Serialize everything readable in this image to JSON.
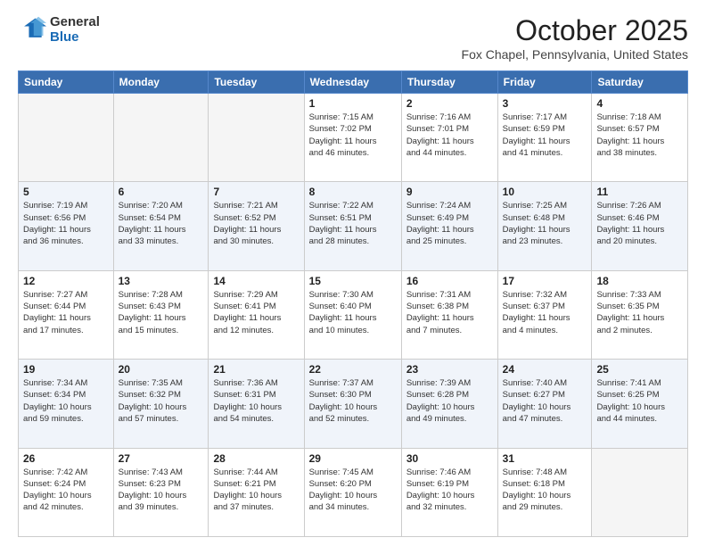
{
  "logo": {
    "general": "General",
    "blue": "Blue"
  },
  "header": {
    "month": "October 2025",
    "location": "Fox Chapel, Pennsylvania, United States"
  },
  "days_of_week": [
    "Sunday",
    "Monday",
    "Tuesday",
    "Wednesday",
    "Thursday",
    "Friday",
    "Saturday"
  ],
  "weeks": [
    [
      {
        "day": "",
        "info": ""
      },
      {
        "day": "",
        "info": ""
      },
      {
        "day": "",
        "info": ""
      },
      {
        "day": "1",
        "info": "Sunrise: 7:15 AM\nSunset: 7:02 PM\nDaylight: 11 hours\nand 46 minutes."
      },
      {
        "day": "2",
        "info": "Sunrise: 7:16 AM\nSunset: 7:01 PM\nDaylight: 11 hours\nand 44 minutes."
      },
      {
        "day": "3",
        "info": "Sunrise: 7:17 AM\nSunset: 6:59 PM\nDaylight: 11 hours\nand 41 minutes."
      },
      {
        "day": "4",
        "info": "Sunrise: 7:18 AM\nSunset: 6:57 PM\nDaylight: 11 hours\nand 38 minutes."
      }
    ],
    [
      {
        "day": "5",
        "info": "Sunrise: 7:19 AM\nSunset: 6:56 PM\nDaylight: 11 hours\nand 36 minutes."
      },
      {
        "day": "6",
        "info": "Sunrise: 7:20 AM\nSunset: 6:54 PM\nDaylight: 11 hours\nand 33 minutes."
      },
      {
        "day": "7",
        "info": "Sunrise: 7:21 AM\nSunset: 6:52 PM\nDaylight: 11 hours\nand 30 minutes."
      },
      {
        "day": "8",
        "info": "Sunrise: 7:22 AM\nSunset: 6:51 PM\nDaylight: 11 hours\nand 28 minutes."
      },
      {
        "day": "9",
        "info": "Sunrise: 7:24 AM\nSunset: 6:49 PM\nDaylight: 11 hours\nand 25 minutes."
      },
      {
        "day": "10",
        "info": "Sunrise: 7:25 AM\nSunset: 6:48 PM\nDaylight: 11 hours\nand 23 minutes."
      },
      {
        "day": "11",
        "info": "Sunrise: 7:26 AM\nSunset: 6:46 PM\nDaylight: 11 hours\nand 20 minutes."
      }
    ],
    [
      {
        "day": "12",
        "info": "Sunrise: 7:27 AM\nSunset: 6:44 PM\nDaylight: 11 hours\nand 17 minutes."
      },
      {
        "day": "13",
        "info": "Sunrise: 7:28 AM\nSunset: 6:43 PM\nDaylight: 11 hours\nand 15 minutes."
      },
      {
        "day": "14",
        "info": "Sunrise: 7:29 AM\nSunset: 6:41 PM\nDaylight: 11 hours\nand 12 minutes."
      },
      {
        "day": "15",
        "info": "Sunrise: 7:30 AM\nSunset: 6:40 PM\nDaylight: 11 hours\nand 10 minutes."
      },
      {
        "day": "16",
        "info": "Sunrise: 7:31 AM\nSunset: 6:38 PM\nDaylight: 11 hours\nand 7 minutes."
      },
      {
        "day": "17",
        "info": "Sunrise: 7:32 AM\nSunset: 6:37 PM\nDaylight: 11 hours\nand 4 minutes."
      },
      {
        "day": "18",
        "info": "Sunrise: 7:33 AM\nSunset: 6:35 PM\nDaylight: 11 hours\nand 2 minutes."
      }
    ],
    [
      {
        "day": "19",
        "info": "Sunrise: 7:34 AM\nSunset: 6:34 PM\nDaylight: 10 hours\nand 59 minutes."
      },
      {
        "day": "20",
        "info": "Sunrise: 7:35 AM\nSunset: 6:32 PM\nDaylight: 10 hours\nand 57 minutes."
      },
      {
        "day": "21",
        "info": "Sunrise: 7:36 AM\nSunset: 6:31 PM\nDaylight: 10 hours\nand 54 minutes."
      },
      {
        "day": "22",
        "info": "Sunrise: 7:37 AM\nSunset: 6:30 PM\nDaylight: 10 hours\nand 52 minutes."
      },
      {
        "day": "23",
        "info": "Sunrise: 7:39 AM\nSunset: 6:28 PM\nDaylight: 10 hours\nand 49 minutes."
      },
      {
        "day": "24",
        "info": "Sunrise: 7:40 AM\nSunset: 6:27 PM\nDaylight: 10 hours\nand 47 minutes."
      },
      {
        "day": "25",
        "info": "Sunrise: 7:41 AM\nSunset: 6:25 PM\nDaylight: 10 hours\nand 44 minutes."
      }
    ],
    [
      {
        "day": "26",
        "info": "Sunrise: 7:42 AM\nSunset: 6:24 PM\nDaylight: 10 hours\nand 42 minutes."
      },
      {
        "day": "27",
        "info": "Sunrise: 7:43 AM\nSunset: 6:23 PM\nDaylight: 10 hours\nand 39 minutes."
      },
      {
        "day": "28",
        "info": "Sunrise: 7:44 AM\nSunset: 6:21 PM\nDaylight: 10 hours\nand 37 minutes."
      },
      {
        "day": "29",
        "info": "Sunrise: 7:45 AM\nSunset: 6:20 PM\nDaylight: 10 hours\nand 34 minutes."
      },
      {
        "day": "30",
        "info": "Sunrise: 7:46 AM\nSunset: 6:19 PM\nDaylight: 10 hours\nand 32 minutes."
      },
      {
        "day": "31",
        "info": "Sunrise: 7:48 AM\nSunset: 6:18 PM\nDaylight: 10 hours\nand 29 minutes."
      },
      {
        "day": "",
        "info": ""
      }
    ]
  ]
}
